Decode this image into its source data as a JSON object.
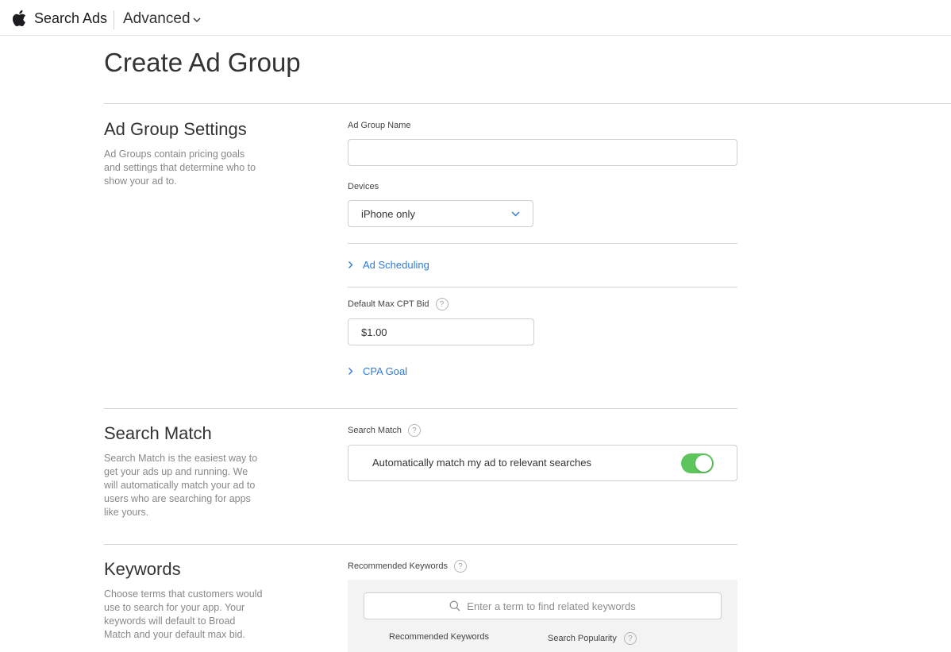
{
  "header": {
    "brand": "Search Ads",
    "product": "Advanced"
  },
  "page": {
    "title": "Create Ad Group"
  },
  "ad_group_settings": {
    "title": "Ad Group Settings",
    "description": "Ad Groups contain pricing goals and settings that determine who to show your ad to.",
    "name_label": "Ad Group Name",
    "name_value": "",
    "devices_label": "Devices",
    "devices_value": "iPhone only",
    "ad_scheduling": "Ad Scheduling",
    "bid_label": "Default Max CPT Bid",
    "bid_value": "$1.00",
    "cpa_goal": "CPA Goal"
  },
  "search_match": {
    "title": "Search Match",
    "description": "Search Match is the easiest way to get your ads up and running. We will automatically match your ad to users who are searching for apps like yours.",
    "label": "Search Match",
    "toggle_text": "Automatically match my ad to relevant searches",
    "enabled": true
  },
  "keywords": {
    "title": "Keywords",
    "description": "Choose terms that customers would use to search for your app. Your keywords will default to Broad Match and your default max bid.",
    "recommended_label": "Recommended Keywords",
    "search_placeholder": "Enter a term to find related keywords",
    "columns": [
      "Recommended Keywords",
      "Search Popularity"
    ]
  },
  "help_glyph": "?",
  "colors": {
    "link": "#2f7bd6",
    "toggle_on": "#5cc65c"
  }
}
